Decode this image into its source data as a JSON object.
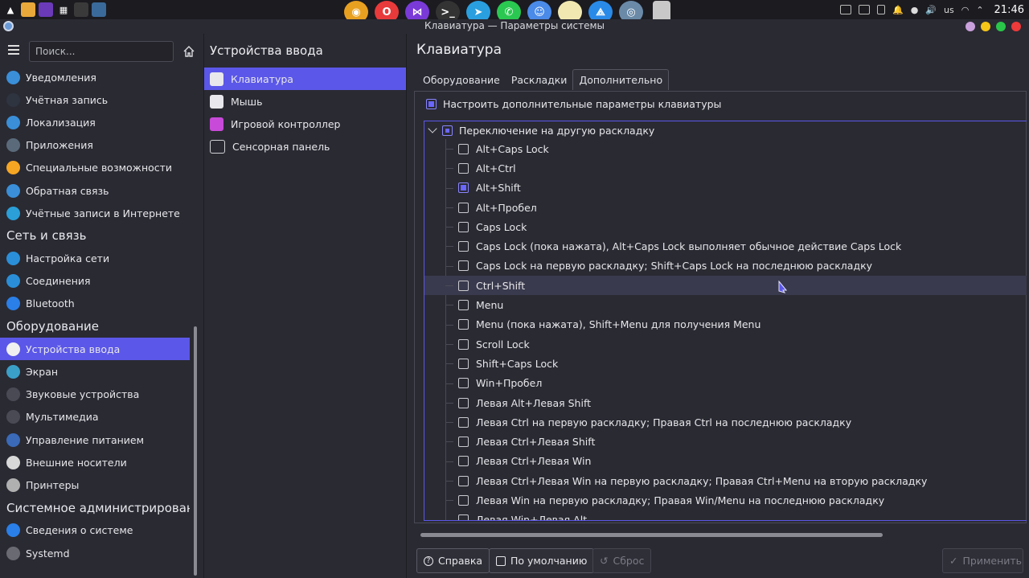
{
  "window": {
    "title": "Клавиатура — Параметры системы"
  },
  "topbar": {
    "clock": "21:46",
    "layout": "us"
  },
  "sidebar": {
    "search_placeholder": "Поиск...",
    "items": [
      {
        "type": "item",
        "label": "Уведомления",
        "icon": "bell-icon",
        "color": "#3a8fd8"
      },
      {
        "type": "item",
        "label": "Учётная запись",
        "icon": "user-icon",
        "color": "#2e3440"
      },
      {
        "type": "item",
        "label": "Локализация",
        "icon": "globe-icon",
        "color": "#3a8fd8"
      },
      {
        "type": "item",
        "label": "Приложения",
        "icon": "apps-icon",
        "color": "#5a6a7a"
      },
      {
        "type": "item",
        "label": "Специальные возможности",
        "icon": "accessibility-icon",
        "color": "#f5a623"
      },
      {
        "type": "item",
        "label": "Обратная связь",
        "icon": "feedback-icon",
        "color": "#3a8fd8"
      },
      {
        "type": "item",
        "label": "Учётные записи в Интернете",
        "icon": "online-accounts-icon",
        "color": "#2a9fd8"
      },
      {
        "type": "category",
        "label": "Сеть и связь"
      },
      {
        "type": "item",
        "label": "Настройка сети",
        "icon": "network-icon",
        "color": "#2a8fd8"
      },
      {
        "type": "item",
        "label": "Соединения",
        "icon": "connections-icon",
        "color": "#2a8fd8"
      },
      {
        "type": "item",
        "label": "Bluetooth",
        "icon": "bluetooth-icon",
        "color": "#2a7fe8"
      },
      {
        "type": "category",
        "label": "Оборудование"
      },
      {
        "type": "item",
        "label": "Устройства ввода",
        "icon": "mouse-icon",
        "color": "#f0f0f0",
        "active": true
      },
      {
        "type": "item",
        "label": "Экран",
        "icon": "display-icon",
        "color": "#3aa0c8"
      },
      {
        "type": "item",
        "label": "Звуковые устройства",
        "icon": "speaker-icon",
        "color": "#4a4a55"
      },
      {
        "type": "item",
        "label": "Мультимедиа",
        "icon": "multimedia-icon",
        "color": "#4a4a55"
      },
      {
        "type": "item",
        "label": "Управление питанием",
        "icon": "battery-icon",
        "color": "#3a6ab8"
      },
      {
        "type": "item",
        "label": "Внешние носители",
        "icon": "drive-icon",
        "color": "#d8d8d8"
      },
      {
        "type": "item",
        "label": "Принтеры",
        "icon": "printer-icon",
        "color": "#b0b0b0"
      },
      {
        "type": "category",
        "label": "Системное администрировани"
      },
      {
        "type": "item",
        "label": "Сведения о системе",
        "icon": "info-icon",
        "color": "#2a7fe8"
      },
      {
        "type": "item",
        "label": "Systemd",
        "icon": "gear-icon",
        "color": "#6a6a72"
      }
    ]
  },
  "middle": {
    "title": "Устройства ввода",
    "items": [
      {
        "label": "Клавиатура",
        "icon": "keyboard-icon",
        "active": true
      },
      {
        "label": "Мышь",
        "icon": "mouse-icon"
      },
      {
        "label": "Игровой контроллер",
        "icon": "gamepad-icon"
      },
      {
        "label": "Сенсорная панель",
        "icon": "touchpad-icon"
      }
    ]
  },
  "main": {
    "title": "Клавиатура",
    "tabs": [
      "Оборудование",
      "Раскладки",
      "Дополнительно"
    ],
    "active_tab": 2,
    "configure_label": "Настроить дополнительные параметры клавиатуры",
    "group_label": "Переключение на другую раскладку",
    "options": [
      {
        "label": "Alt+Caps Lock",
        "checked": false
      },
      {
        "label": "Alt+Ctrl",
        "checked": false
      },
      {
        "label": "Alt+Shift",
        "checked": true
      },
      {
        "label": "Alt+Пробел",
        "checked": false
      },
      {
        "label": "Caps Lock",
        "checked": false
      },
      {
        "label": "Caps Lock (пока нажата), Alt+Caps Lock выполняет обычное действие Caps Lock",
        "checked": false
      },
      {
        "label": "Caps Lock на первую раскладку; Shift+Caps Lock на последнюю раскладку",
        "checked": false
      },
      {
        "label": "Ctrl+Shift",
        "checked": false,
        "hover": true
      },
      {
        "label": "Menu",
        "checked": false
      },
      {
        "label": "Menu (пока нажата), Shift+Menu для получения Menu",
        "checked": false
      },
      {
        "label": "Scroll Lock",
        "checked": false
      },
      {
        "label": "Shift+Caps Lock",
        "checked": false
      },
      {
        "label": "Win+Пробел",
        "checked": false
      },
      {
        "label": "Левая Alt+Левая Shift",
        "checked": false
      },
      {
        "label": "Левая Ctrl на первую раскладку; Правая Ctrl на последнюю раскладку",
        "checked": false
      },
      {
        "label": "Левая Ctrl+Левая Shift",
        "checked": false
      },
      {
        "label": "Левая Ctrl+Левая Win",
        "checked": false
      },
      {
        "label": "Левая Ctrl+Левая Win на первую раскладку; Правая Ctrl+Menu на вторую раскладку",
        "checked": false
      },
      {
        "label": "Левая Win на первую раскладку; Правая Win/Menu на последнюю раскладку",
        "checked": false
      },
      {
        "label": "Левая Win+Левая Alt",
        "checked": false
      }
    ]
  },
  "buttons": {
    "help": "Справка",
    "defaults": "По умолчанию",
    "reset": "Сброс",
    "apply": "Применить"
  },
  "colors": {
    "accent": "#5b57e8",
    "background": "#2a2a33"
  }
}
